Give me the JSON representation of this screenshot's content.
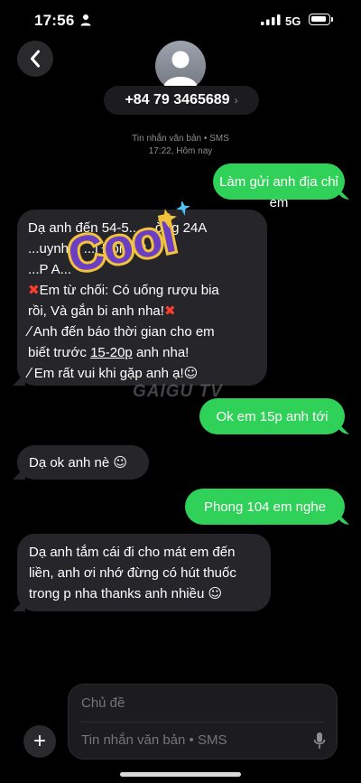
{
  "status_bar": {
    "time": "17:56",
    "network": "5G"
  },
  "header": {
    "contact_number": "+84 79 3465689",
    "chevron": "›"
  },
  "thread_meta": {
    "type": "Tin nhắn văn bản • SMS",
    "time": "17:22, Hôm nay"
  },
  "messages": {
    "m1": {
      "text": "Làm gửi anh địa chỉ em"
    },
    "m2": {
      "line1": "Dạ anh đến 54-5... ...ờng 24A",
      "line2": "...uynh... ...ị Đông B,",
      "line3": "...P A...",
      "line4": "Em từ chối: Có uống rượu bia",
      "line5": "rồi, Và gắn bi anh nha!",
      "line6": "Anh đến báo thời gian cho em",
      "line7_pre": "biết trước ",
      "line7_u": "15-20p",
      "line7_post": " anh nha!",
      "line8": "Em rất vui khi gặp anh ạ!"
    },
    "m3": {
      "text": "Ok em 15p anh tới"
    },
    "m4": {
      "text": "Dạ ok anh nè"
    },
    "m5": {
      "text": "Phong 104 em nghe"
    },
    "m6": {
      "line1": "Dạ anh tắm cái đi cho mát em đến",
      "line2": "liền, anh ơi nhớ đừng có hút thuốc",
      "line3": "trong p nha thanks anh nhiều"
    }
  },
  "emoji": {
    "cross_mark": "✖",
    "wand": "⁄",
    "smile": "☺"
  },
  "sticker": {
    "text": "Cool"
  },
  "watermark": {
    "text": "GAIGU TV"
  },
  "composer": {
    "subject_placeholder": "Chủ đề",
    "message_placeholder": "Tin nhắn văn bản • SMS",
    "add_label": "+"
  },
  "colors": {
    "outgoing": "#30d158",
    "incoming": "#26262a",
    "background": "#000000"
  },
  "icons": [
    "back-chevron-icon",
    "person-icon",
    "signal-icon",
    "battery-icon",
    "plus-icon",
    "microphone-icon"
  ]
}
